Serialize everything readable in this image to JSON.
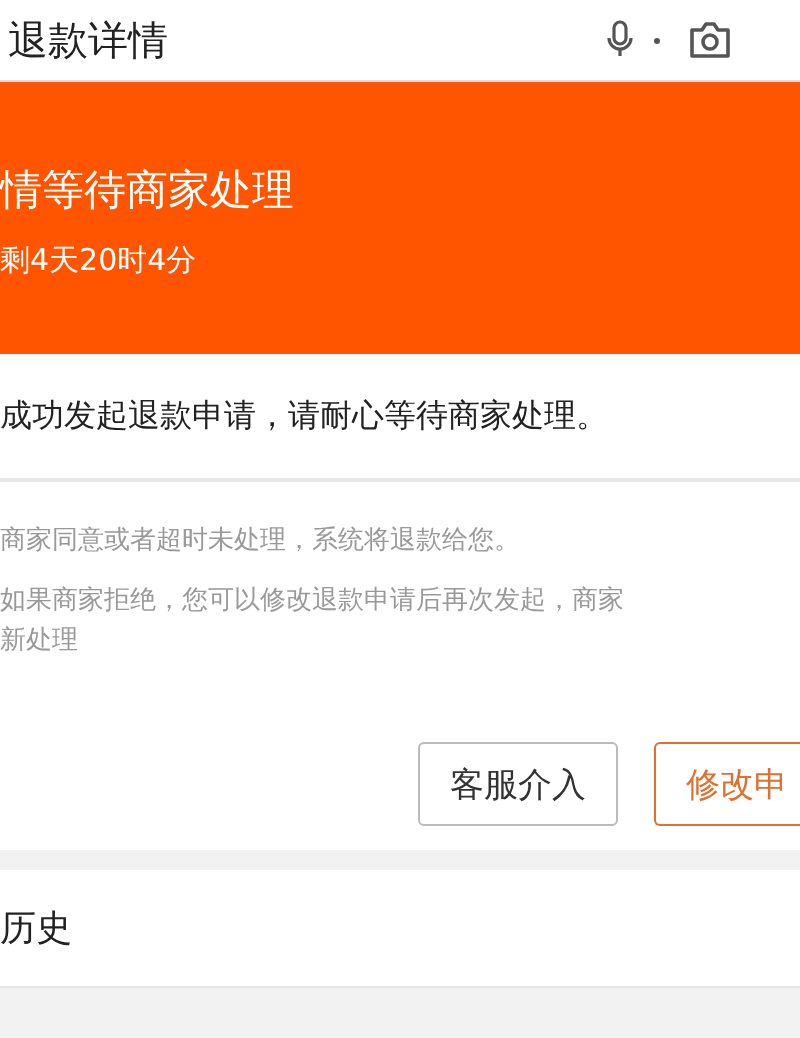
{
  "header": {
    "title": "退款详情"
  },
  "status": {
    "title": "情等待商家处理",
    "countdown": "剩4天20时4分"
  },
  "message": "成功发起退款申请，请耐心等待商家处理。",
  "notes": [
    {
      "lines": [
        "商家同意或者超时未处理，系统将退款给您。"
      ]
    },
    {
      "lines": [
        "如果商家拒绝，您可以修改退款申请后再次发起，商家",
        "新处理"
      ]
    }
  ],
  "buttons": [
    {
      "label": "客服介入",
      "kind": "plain"
    },
    {
      "label": "修改申",
      "kind": "primary"
    }
  ],
  "history": {
    "title": "历史"
  }
}
